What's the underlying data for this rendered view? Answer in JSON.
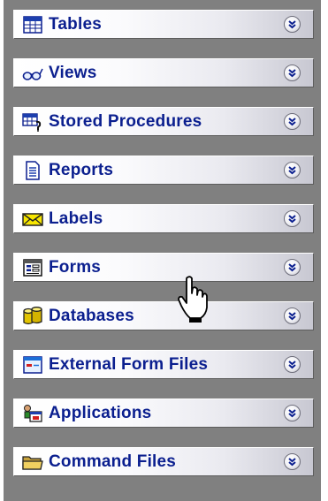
{
  "sections": [
    {
      "label": "Tables",
      "icon": "table-icon"
    },
    {
      "label": "Views",
      "icon": "glasses-icon"
    },
    {
      "label": "Stored Procedures",
      "icon": "stored-procedure-icon"
    },
    {
      "label": "Reports",
      "icon": "report-icon"
    },
    {
      "label": "Labels",
      "icon": "envelope-icon"
    },
    {
      "label": "Forms",
      "icon": "form-icon"
    },
    {
      "label": "Databases",
      "icon": "database-icon"
    },
    {
      "label": "External Form Files",
      "icon": "external-form-icon"
    },
    {
      "label": "Applications",
      "icon": "application-icon"
    },
    {
      "label": "Command Files",
      "icon": "folder-icon"
    }
  ],
  "colors": {
    "label": "#0b1f8f",
    "panel_background": "#808080",
    "bar_highlight": "#ffffff"
  },
  "cursor": {
    "icon": "hand-pointer-icon"
  }
}
